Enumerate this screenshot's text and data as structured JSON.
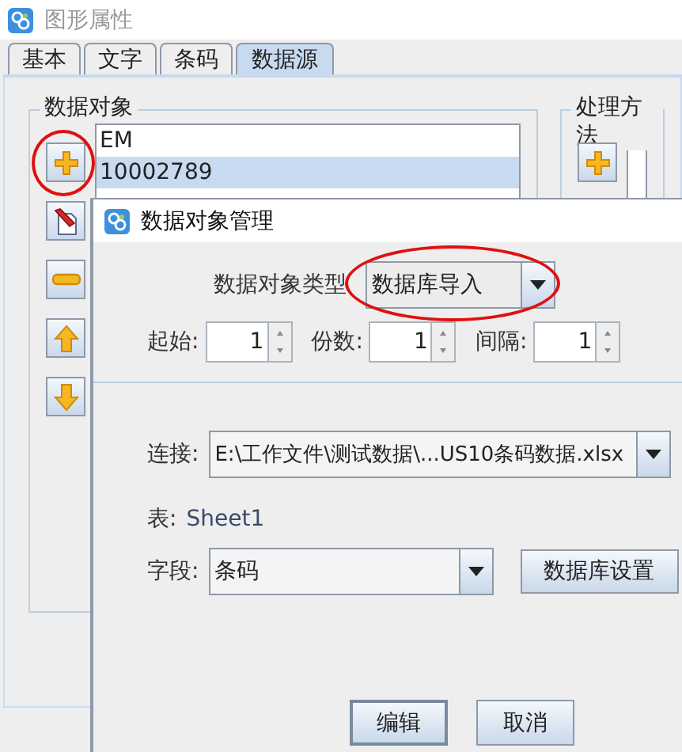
{
  "background_window": {
    "title": "图形属性",
    "tabs": [
      {
        "label": "基本",
        "selected": false
      },
      {
        "label": "文字",
        "selected": false
      },
      {
        "label": "条码",
        "selected": false
      },
      {
        "label": "数据源",
        "selected": true
      }
    ],
    "data_objects": {
      "title": "数据对象",
      "items": [
        {
          "text": "EM",
          "selected": false
        },
        {
          "text": "10002789",
          "selected": true
        }
      ],
      "buttons": [
        {
          "kind": "add",
          "circled": true
        },
        {
          "kind": "edit",
          "circled": false
        },
        {
          "kind": "remove",
          "circled": false
        },
        {
          "kind": "up",
          "circled": false
        },
        {
          "kind": "down",
          "circled": false
        }
      ]
    },
    "processing": {
      "title": "处理方法",
      "buttons": [
        {
          "kind": "add",
          "circled": false
        }
      ]
    }
  },
  "dialog": {
    "title": "数据对象管理",
    "type_field": {
      "label": "数据对象类型",
      "value": "数据库导入",
      "circled": true
    },
    "spinners": [
      {
        "label": "起始:",
        "value": "1"
      },
      {
        "label": "份数:",
        "value": "1"
      },
      {
        "label": "间隔:",
        "value": "1"
      }
    ],
    "connection": {
      "label": "连接:",
      "value": "E:\\工作文件\\测试数据\\...US10条码数据.xlsx"
    },
    "table": {
      "label": "表:",
      "value": "Sheet1"
    },
    "field": {
      "label": "字段:",
      "value": "条码"
    },
    "settings_button": "数据库设置",
    "buttons": [
      {
        "label": "编辑",
        "focused": true
      },
      {
        "label": "取消",
        "focused": false
      }
    ]
  }
}
